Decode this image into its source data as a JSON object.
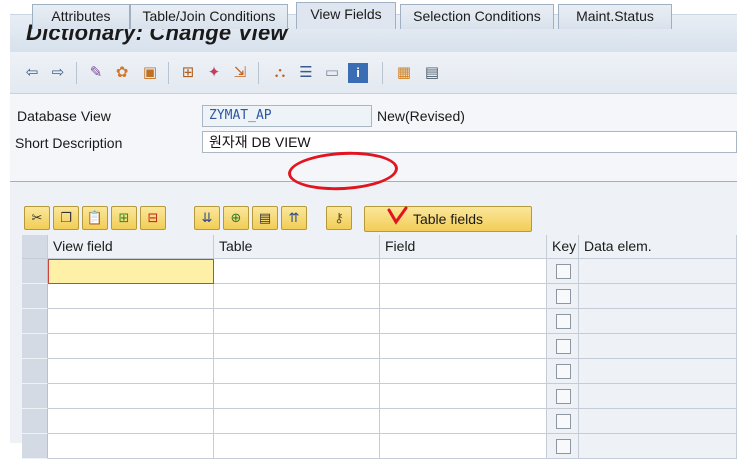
{
  "window": {
    "title": "Dictionary: Change View"
  },
  "toolbar": {
    "icons": [
      "back-arrow-icon",
      "forward-arrow-icon",
      "glasses-pencil-icon",
      "object-activate-icon",
      "object-display-icon",
      "where-used-icon",
      "magic-wand-icon",
      "navigate-icon",
      "hierarchy-icon",
      "list-icon",
      "frame-icon",
      "info-icon",
      "settings-icon",
      "table-view-icon"
    ]
  },
  "form": {
    "database_view_label": "Database View",
    "database_view_value": "ZYMAT_AP",
    "status": "New(Revised)",
    "short_description_label": "Short Description",
    "short_description_value": "원자재 DB VIEW"
  },
  "tabs": [
    {
      "label": "Attributes",
      "active": false
    },
    {
      "label": "Table/Join Conditions",
      "active": false
    },
    {
      "label": "View Fields",
      "active": true
    },
    {
      "label": "Selection Conditions",
      "active": false
    },
    {
      "label": "Maint.Status",
      "active": false
    }
  ],
  "table_toolbar": {
    "buttons": [
      "cut-icon",
      "copy-icon",
      "paste-icon",
      "insert-row-icon",
      "delete-row-icon",
      "sort-icon",
      "insert-field-icon",
      "choose-icon",
      "move-up-icon",
      "key-icon"
    ],
    "table_fields_label": "Table fields"
  },
  "grid": {
    "columns": [
      "View field",
      "Table",
      "Field",
      "Key",
      "Data elem."
    ],
    "row_count": 8
  },
  "colors": {
    "accent_highlight": "#e1141f",
    "button_yellow": "#f2cd56",
    "header_bg": "#e3e9f0"
  }
}
